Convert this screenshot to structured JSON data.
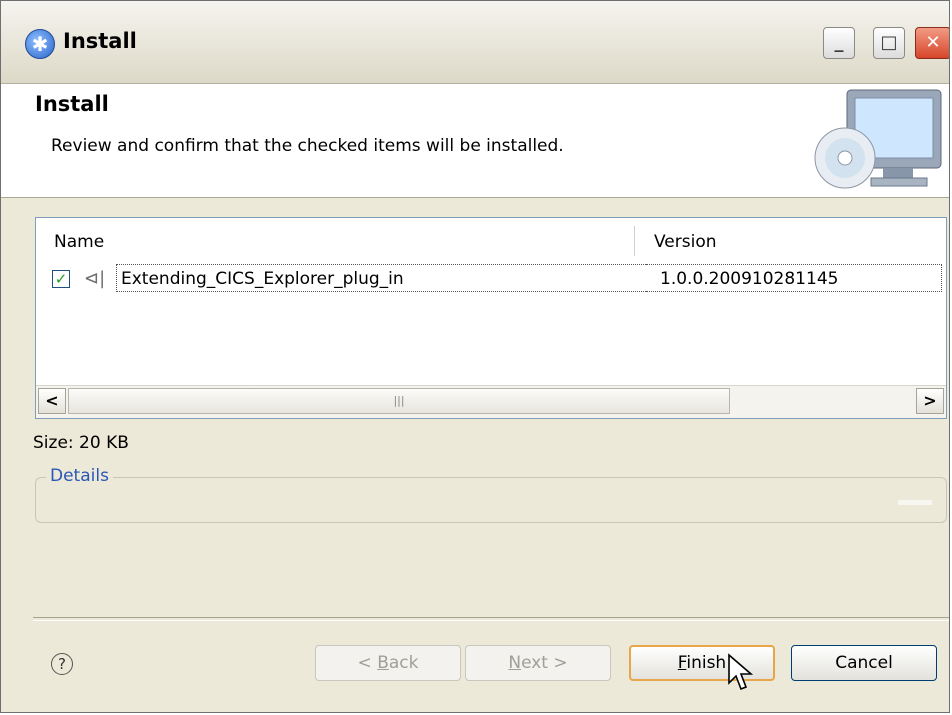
{
  "window": {
    "title": "Install",
    "controls": {
      "minimize": "_",
      "maximize": "□",
      "close": "✕"
    }
  },
  "header": {
    "title": "Install",
    "description": "Review and confirm that the checked items will be installed."
  },
  "table": {
    "columns": [
      "Name",
      "Version"
    ],
    "rows": [
      {
        "checked": true,
        "name": "Extending_CICS_Explorer_plug_in",
        "version": "1.0.0.200910281145"
      }
    ]
  },
  "size": "Size: 20 KB",
  "details": {
    "legend": "Details"
  },
  "buttons": {
    "help": "?",
    "back": {
      "underlined": "B",
      "prefix": "< ",
      "rest": "ack"
    },
    "next": {
      "underlined": "N",
      "rest": "ext >"
    },
    "finish": {
      "underlined": "F",
      "rest": "inish"
    },
    "cancel": "Cancel"
  },
  "colors": {
    "accent": "#2957b7",
    "check": "#21a121",
    "close": "#d6462a"
  },
  "icons": [
    "eclipse-install-icon",
    "computer-cd-icon",
    "plugin-feature-icon",
    "help-icon",
    "mouse-cursor-icon"
  ]
}
